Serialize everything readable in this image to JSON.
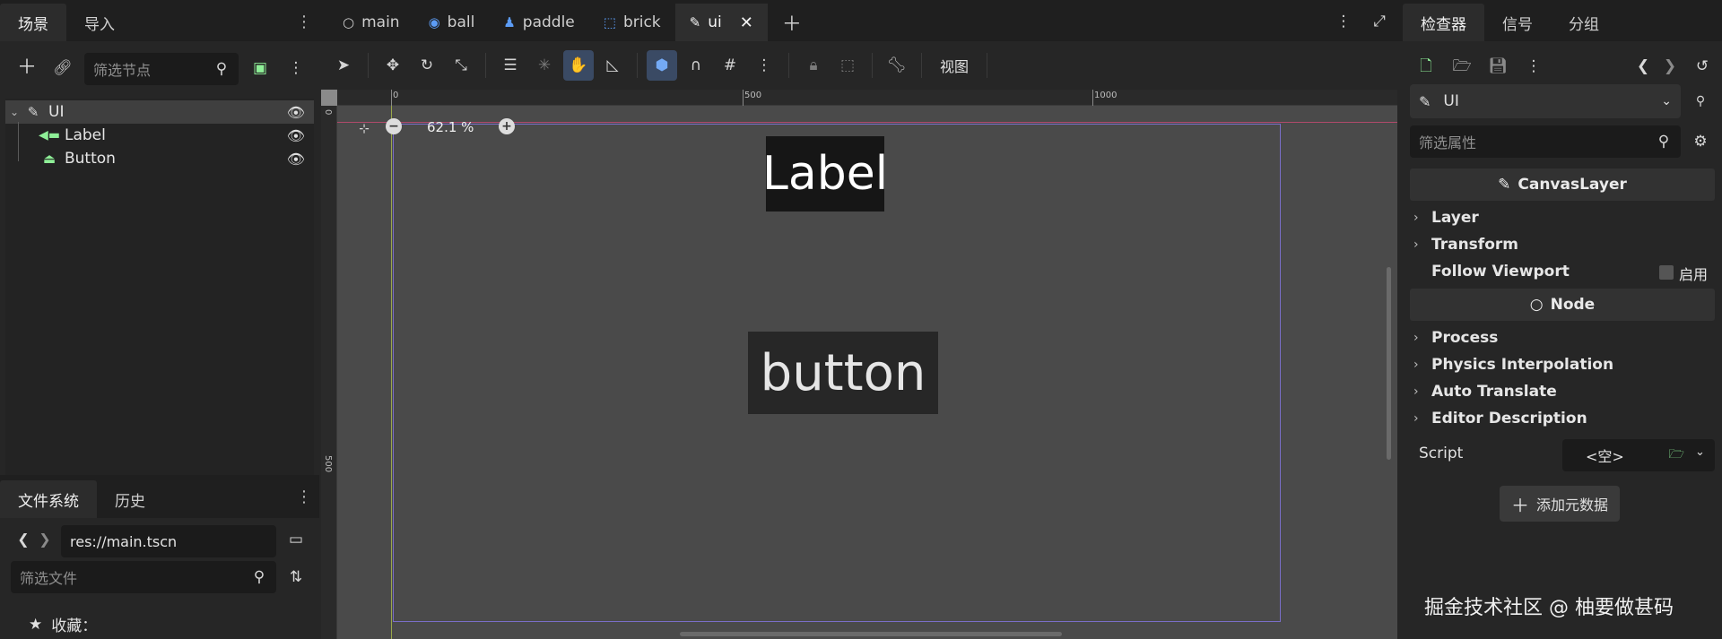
{
  "left_dock": {
    "tabs": [
      "场景",
      "导入"
    ],
    "filter_nodes_placeholder": "筛选节点",
    "tree": [
      {
        "label": "UI",
        "icon": "canvas-layer-icon",
        "selected": true
      },
      {
        "label": "Label",
        "icon": "label-icon",
        "selected": false
      },
      {
        "label": "Button",
        "icon": "button-icon",
        "selected": false
      }
    ]
  },
  "filesystem": {
    "tabs": [
      "文件系统",
      "历史"
    ],
    "path": "res://main.tscn",
    "filter_files_placeholder": "筛选文件",
    "favorites_label": "收藏："
  },
  "center": {
    "scene_tabs": [
      {
        "label": "main",
        "icon": "node-icon",
        "active": false
      },
      {
        "label": "ball",
        "icon": "rigid-body-icon",
        "active": false
      },
      {
        "label": "paddle",
        "icon": "character-body-icon",
        "active": false
      },
      {
        "label": "brick",
        "icon": "static-body-icon",
        "active": false
      },
      {
        "label": "ui",
        "icon": "canvas-layer-icon",
        "active": true
      }
    ],
    "view_menu_label": "视图",
    "zoom_label": "62.1 %",
    "ruler_top": [
      "0",
      "500",
      "1000"
    ],
    "ruler_left": [
      "0",
      "500"
    ],
    "canvas_label_text": "Label",
    "canvas_button_text": "button"
  },
  "inspector": {
    "tabs": [
      "检查器",
      "信号",
      "分组"
    ],
    "node_name": "UI",
    "filter_properties_placeholder": "筛选属性",
    "section_canvaslayer": "CanvasLayer",
    "canvaslayer_props": [
      "Layer",
      "Transform"
    ],
    "follow_viewport_label": "Follow Viewport",
    "follow_viewport_enable": "启用",
    "section_node": "Node",
    "node_props": [
      "Process",
      "Physics Interpolation",
      "Auto Translate",
      "Editor Description"
    ],
    "script_label": "Script",
    "script_value": "<空>",
    "add_metadata_label": "添加元数据"
  },
  "watermark": "掘金技术社区 @ 柚要做甚码",
  "colors": {
    "accent_blue": "#5c9cf5",
    "node_green": "#8eef97",
    "viewport_bg": "#4a4a4a",
    "label_bg": "#161616",
    "button_bg": "#272727"
  }
}
